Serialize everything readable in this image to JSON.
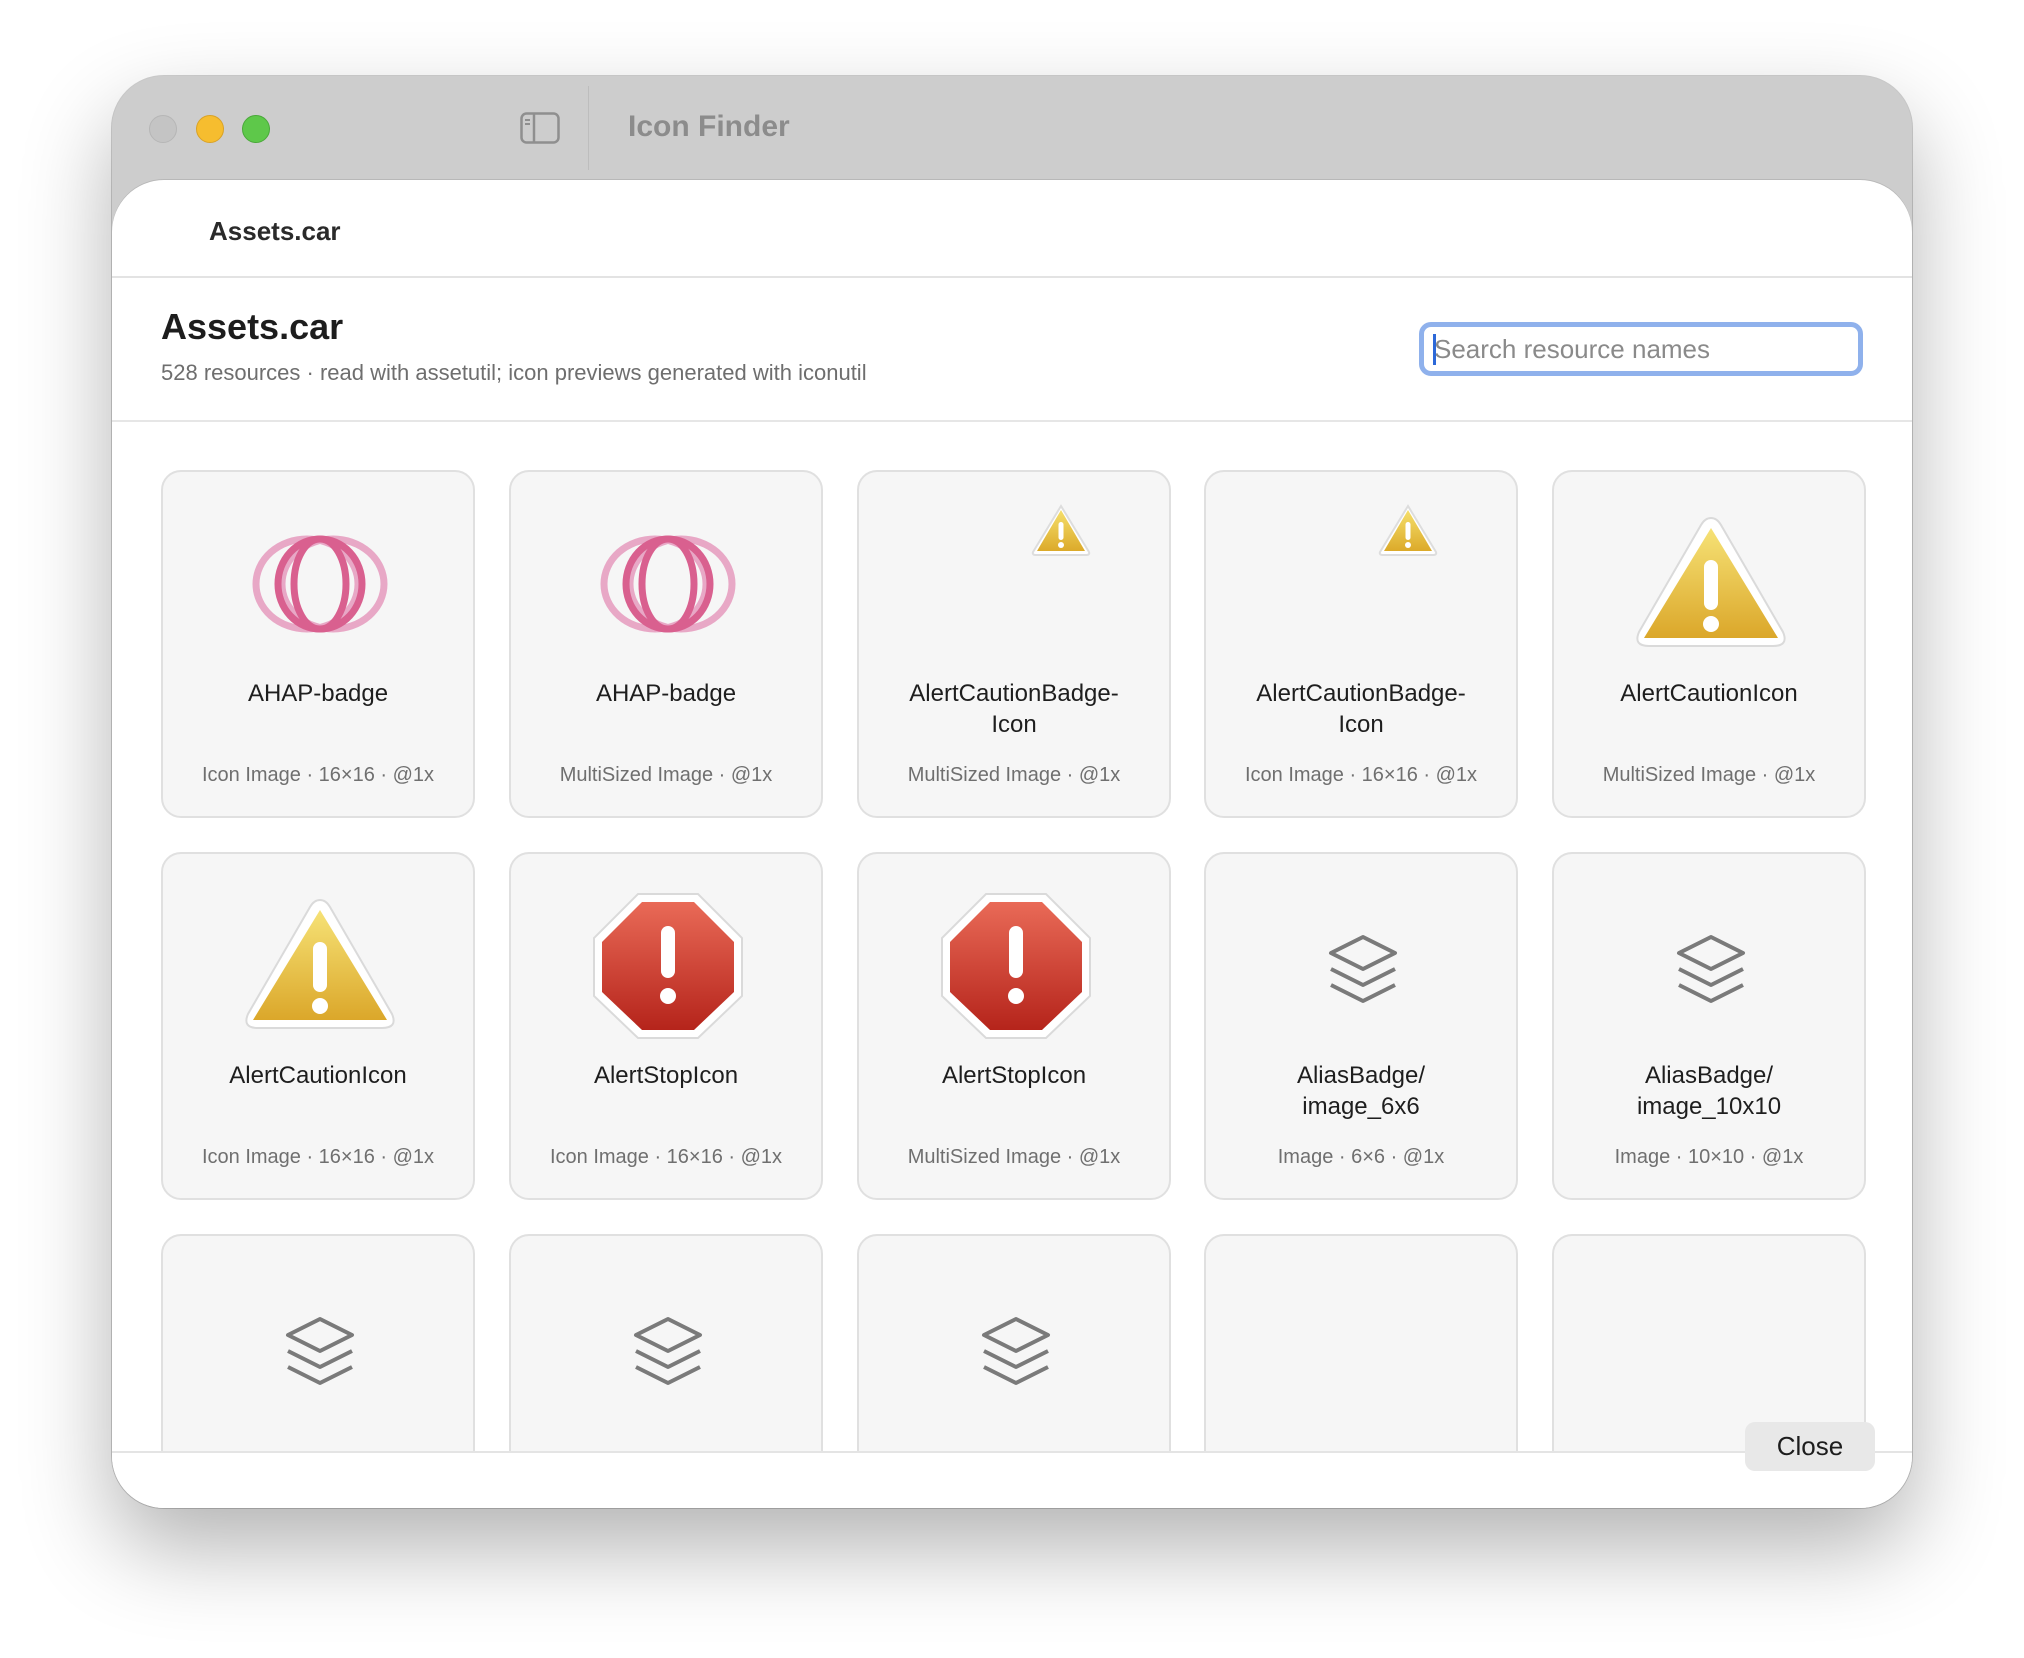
{
  "window": {
    "title": "Icon Finder"
  },
  "sheet": {
    "title": "Assets.car",
    "heading": "Assets.car",
    "subheading": "528 resources · read with assetutil; icon previews generated with iconutil",
    "search": {
      "placeholder": "Search resource names",
      "value": ""
    },
    "close_label": "Close"
  },
  "resources": [
    {
      "name": "AHAP-badge",
      "meta": "Icon Image · 16×16 · @1x",
      "icon": "ahap-rings-icon"
    },
    {
      "name": "AHAP-badge",
      "meta": "MultiSized Image · @1x",
      "icon": "ahap-rings-icon"
    },
    {
      "name": "AlertCautionBadge-\nIcon",
      "meta": "MultiSized Image · @1x",
      "icon": "caution-badge-icon"
    },
    {
      "name": "AlertCautionBadge-\nIcon",
      "meta": "Icon Image · 16×16 · @1x",
      "icon": "caution-badge-icon"
    },
    {
      "name": "AlertCautionIcon",
      "meta": "MultiSized Image · @1x",
      "icon": "caution-triangle-icon"
    },
    {
      "name": "AlertCautionIcon",
      "meta": "Icon Image · 16×16 · @1x",
      "icon": "caution-triangle-icon"
    },
    {
      "name": "AlertStopIcon",
      "meta": "Icon Image · 16×16 · @1x",
      "icon": "stop-octagon-icon"
    },
    {
      "name": "AlertStopIcon",
      "meta": "MultiSized Image · @1x",
      "icon": "stop-octagon-icon"
    },
    {
      "name": "AliasBadge/\nimage_6x6",
      "meta": "Image · 6×6 · @1x",
      "icon": "layers-icon"
    },
    {
      "name": "AliasBadge/\nimage_10x10",
      "meta": "Image · 10×10 · @1x",
      "icon": "layers-icon"
    },
    {
      "name": "",
      "meta": "",
      "icon": "layers-icon"
    },
    {
      "name": "",
      "meta": "",
      "icon": "layers-icon"
    },
    {
      "name": "",
      "meta": "",
      "icon": "layers-icon"
    },
    {
      "name": "",
      "meta": "",
      "icon": "blank"
    },
    {
      "name": "",
      "meta": "",
      "icon": "blank"
    }
  ]
}
